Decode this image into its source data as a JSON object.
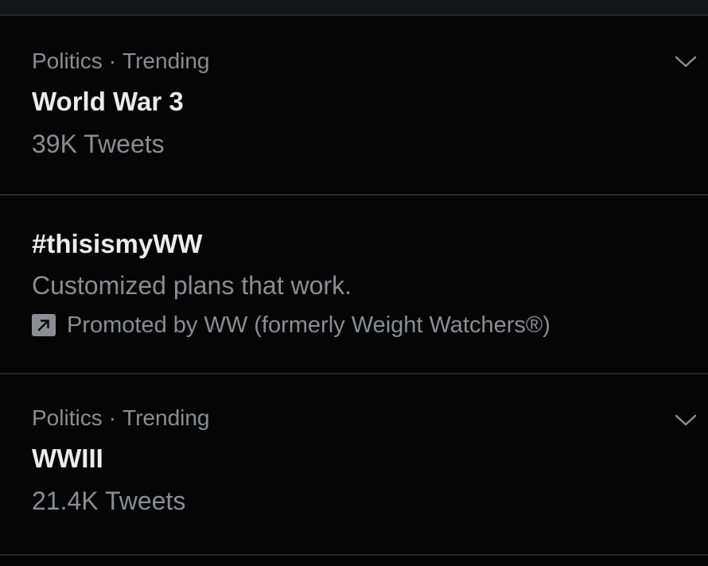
{
  "trends": [
    {
      "category": "Politics",
      "separator": "·",
      "status": "Trending",
      "title": "World War 3",
      "count": "39K Tweets"
    },
    {
      "title": "#thisismyWW",
      "description": "Customized plans that work.",
      "promoted_text": "Promoted by WW (formerly Weight Watchers®)",
      "promoted_icon": "promoted-arrow-icon"
    },
    {
      "category": "Politics",
      "separator": "·",
      "status": "Trending",
      "title": "WWIII",
      "count": "21.4K Tweets"
    }
  ],
  "icons": {
    "more": "chevron-down-icon"
  },
  "colors": {
    "background": "#050505",
    "primary_text": "#ececec",
    "secondary_text": "#8a8d91",
    "divider": "#26292c"
  }
}
